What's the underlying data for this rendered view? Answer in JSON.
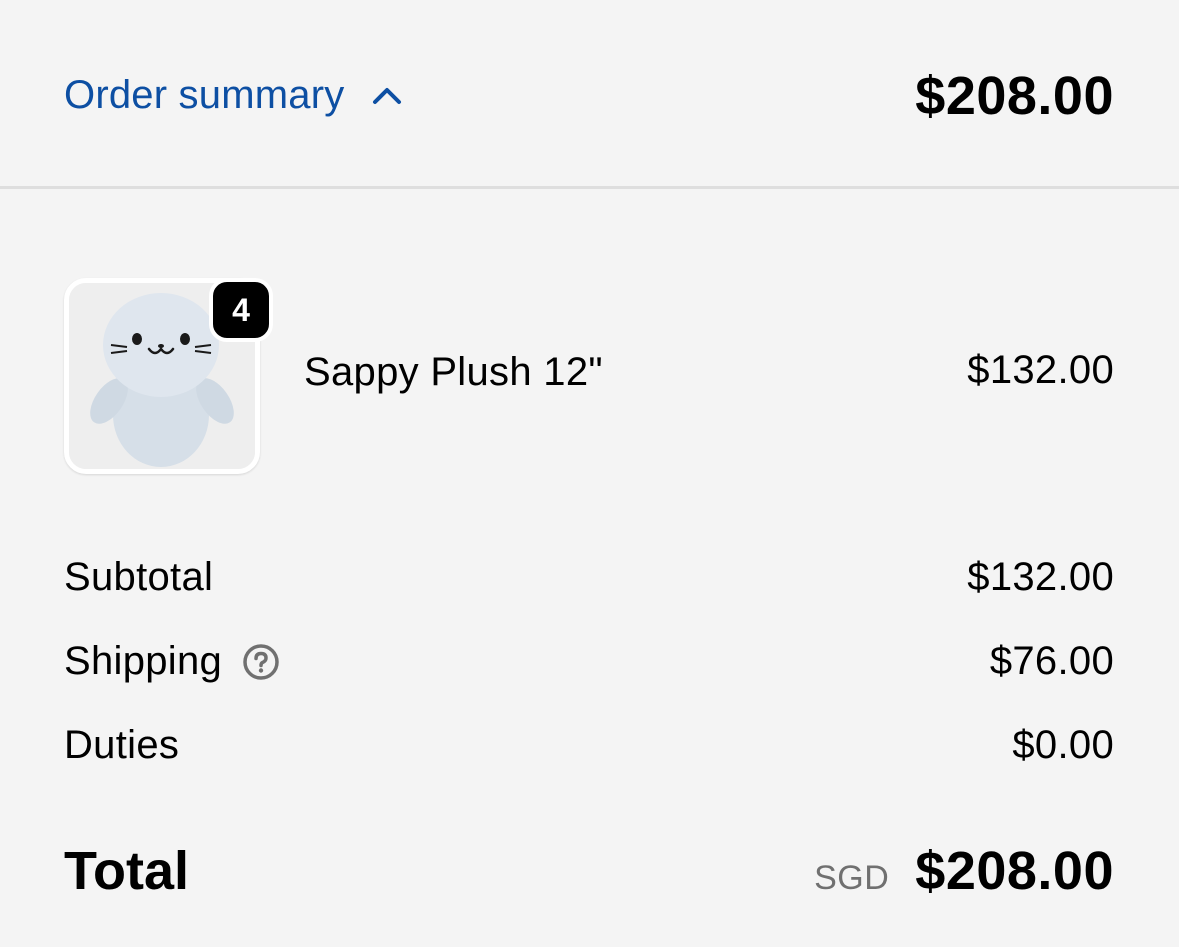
{
  "header": {
    "toggle_label": "Order summary",
    "toggle_icon": "chevron-up-icon",
    "total": "$208.00"
  },
  "line_items": [
    {
      "name": "Sappy Plush 12\"",
      "price": "$132.00",
      "quantity": "4",
      "image_icon": "seal-plush-image"
    }
  ],
  "costs": {
    "subtotal_label": "Subtotal",
    "subtotal_value": "$132.00",
    "shipping_label": "Shipping",
    "shipping_help_icon": "question-circle-icon",
    "shipping_value": "$76.00",
    "duties_label": "Duties",
    "duties_value": "$0.00"
  },
  "total": {
    "label": "Total",
    "currency": "SGD",
    "amount": "$208.00"
  },
  "colors": {
    "background": "#f4f4f4",
    "link": "#0d4fa3",
    "divider": "#dedede",
    "badge": "#000000",
    "muted": "#707070"
  }
}
